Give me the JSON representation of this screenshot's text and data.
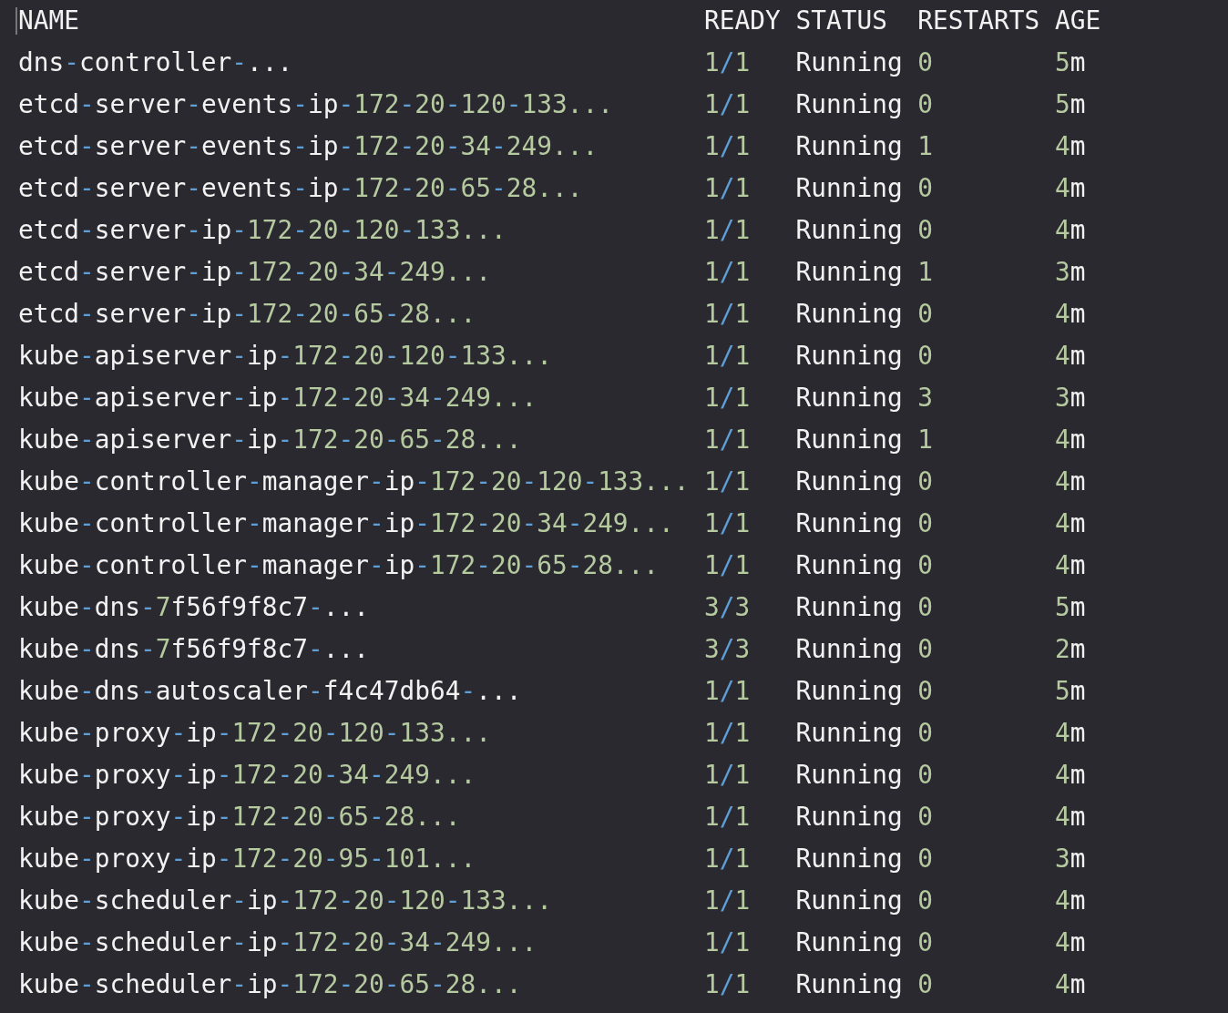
{
  "table": {
    "columns": [
      "NAME",
      "READY",
      "STATUS",
      "RESTARTS",
      "AGE"
    ],
    "rows": [
      [
        "dns-controller-...",
        "1/1",
        "Running",
        "0",
        "5m"
      ],
      [
        "etcd-server-events-ip-172-20-120-133...",
        "1/1",
        "Running",
        "0",
        "5m"
      ],
      [
        "etcd-server-events-ip-172-20-34-249...",
        "1/1",
        "Running",
        "1",
        "4m"
      ],
      [
        "etcd-server-events-ip-172-20-65-28...",
        "1/1",
        "Running",
        "0",
        "4m"
      ],
      [
        "etcd-server-ip-172-20-120-133...",
        "1/1",
        "Running",
        "0",
        "4m"
      ],
      [
        "etcd-server-ip-172-20-34-249...",
        "1/1",
        "Running",
        "1",
        "3m"
      ],
      [
        "etcd-server-ip-172-20-65-28...",
        "1/1",
        "Running",
        "0",
        "4m"
      ],
      [
        "kube-apiserver-ip-172-20-120-133...",
        "1/1",
        "Running",
        "0",
        "4m"
      ],
      [
        "kube-apiserver-ip-172-20-34-249...",
        "1/1",
        "Running",
        "3",
        "3m"
      ],
      [
        "kube-apiserver-ip-172-20-65-28...",
        "1/1",
        "Running",
        "1",
        "4m"
      ],
      [
        "kube-controller-manager-ip-172-20-120-133...",
        "1/1",
        "Running",
        "0",
        "4m"
      ],
      [
        "kube-controller-manager-ip-172-20-34-249...",
        "1/1",
        "Running",
        "0",
        "4m"
      ],
      [
        "kube-controller-manager-ip-172-20-65-28...",
        "1/1",
        "Running",
        "0",
        "4m"
      ],
      [
        "kube-dns-7f56f9f8c7-...",
        "3/3",
        "Running",
        "0",
        "5m"
      ],
      [
        "kube-dns-7f56f9f8c7-...",
        "3/3",
        "Running",
        "0",
        "2m"
      ],
      [
        "kube-dns-autoscaler-f4c47db64-...",
        "1/1",
        "Running",
        "0",
        "5m"
      ],
      [
        "kube-proxy-ip-172-20-120-133...",
        "1/1",
        "Running",
        "0",
        "4m"
      ],
      [
        "kube-proxy-ip-172-20-34-249...",
        "1/1",
        "Running",
        "0",
        "4m"
      ],
      [
        "kube-proxy-ip-172-20-65-28...",
        "1/1",
        "Running",
        "0",
        "4m"
      ],
      [
        "kube-proxy-ip-172-20-95-101...",
        "1/1",
        "Running",
        "0",
        "3m"
      ],
      [
        "kube-scheduler-ip-172-20-120-133...",
        "1/1",
        "Running",
        "0",
        "4m"
      ],
      [
        "kube-scheduler-ip-172-20-34-249...",
        "1/1",
        "Running",
        "0",
        "4m"
      ],
      [
        "kube-scheduler-ip-172-20-65-28...",
        "1/1",
        "Running",
        "0",
        "4m"
      ]
    ]
  }
}
